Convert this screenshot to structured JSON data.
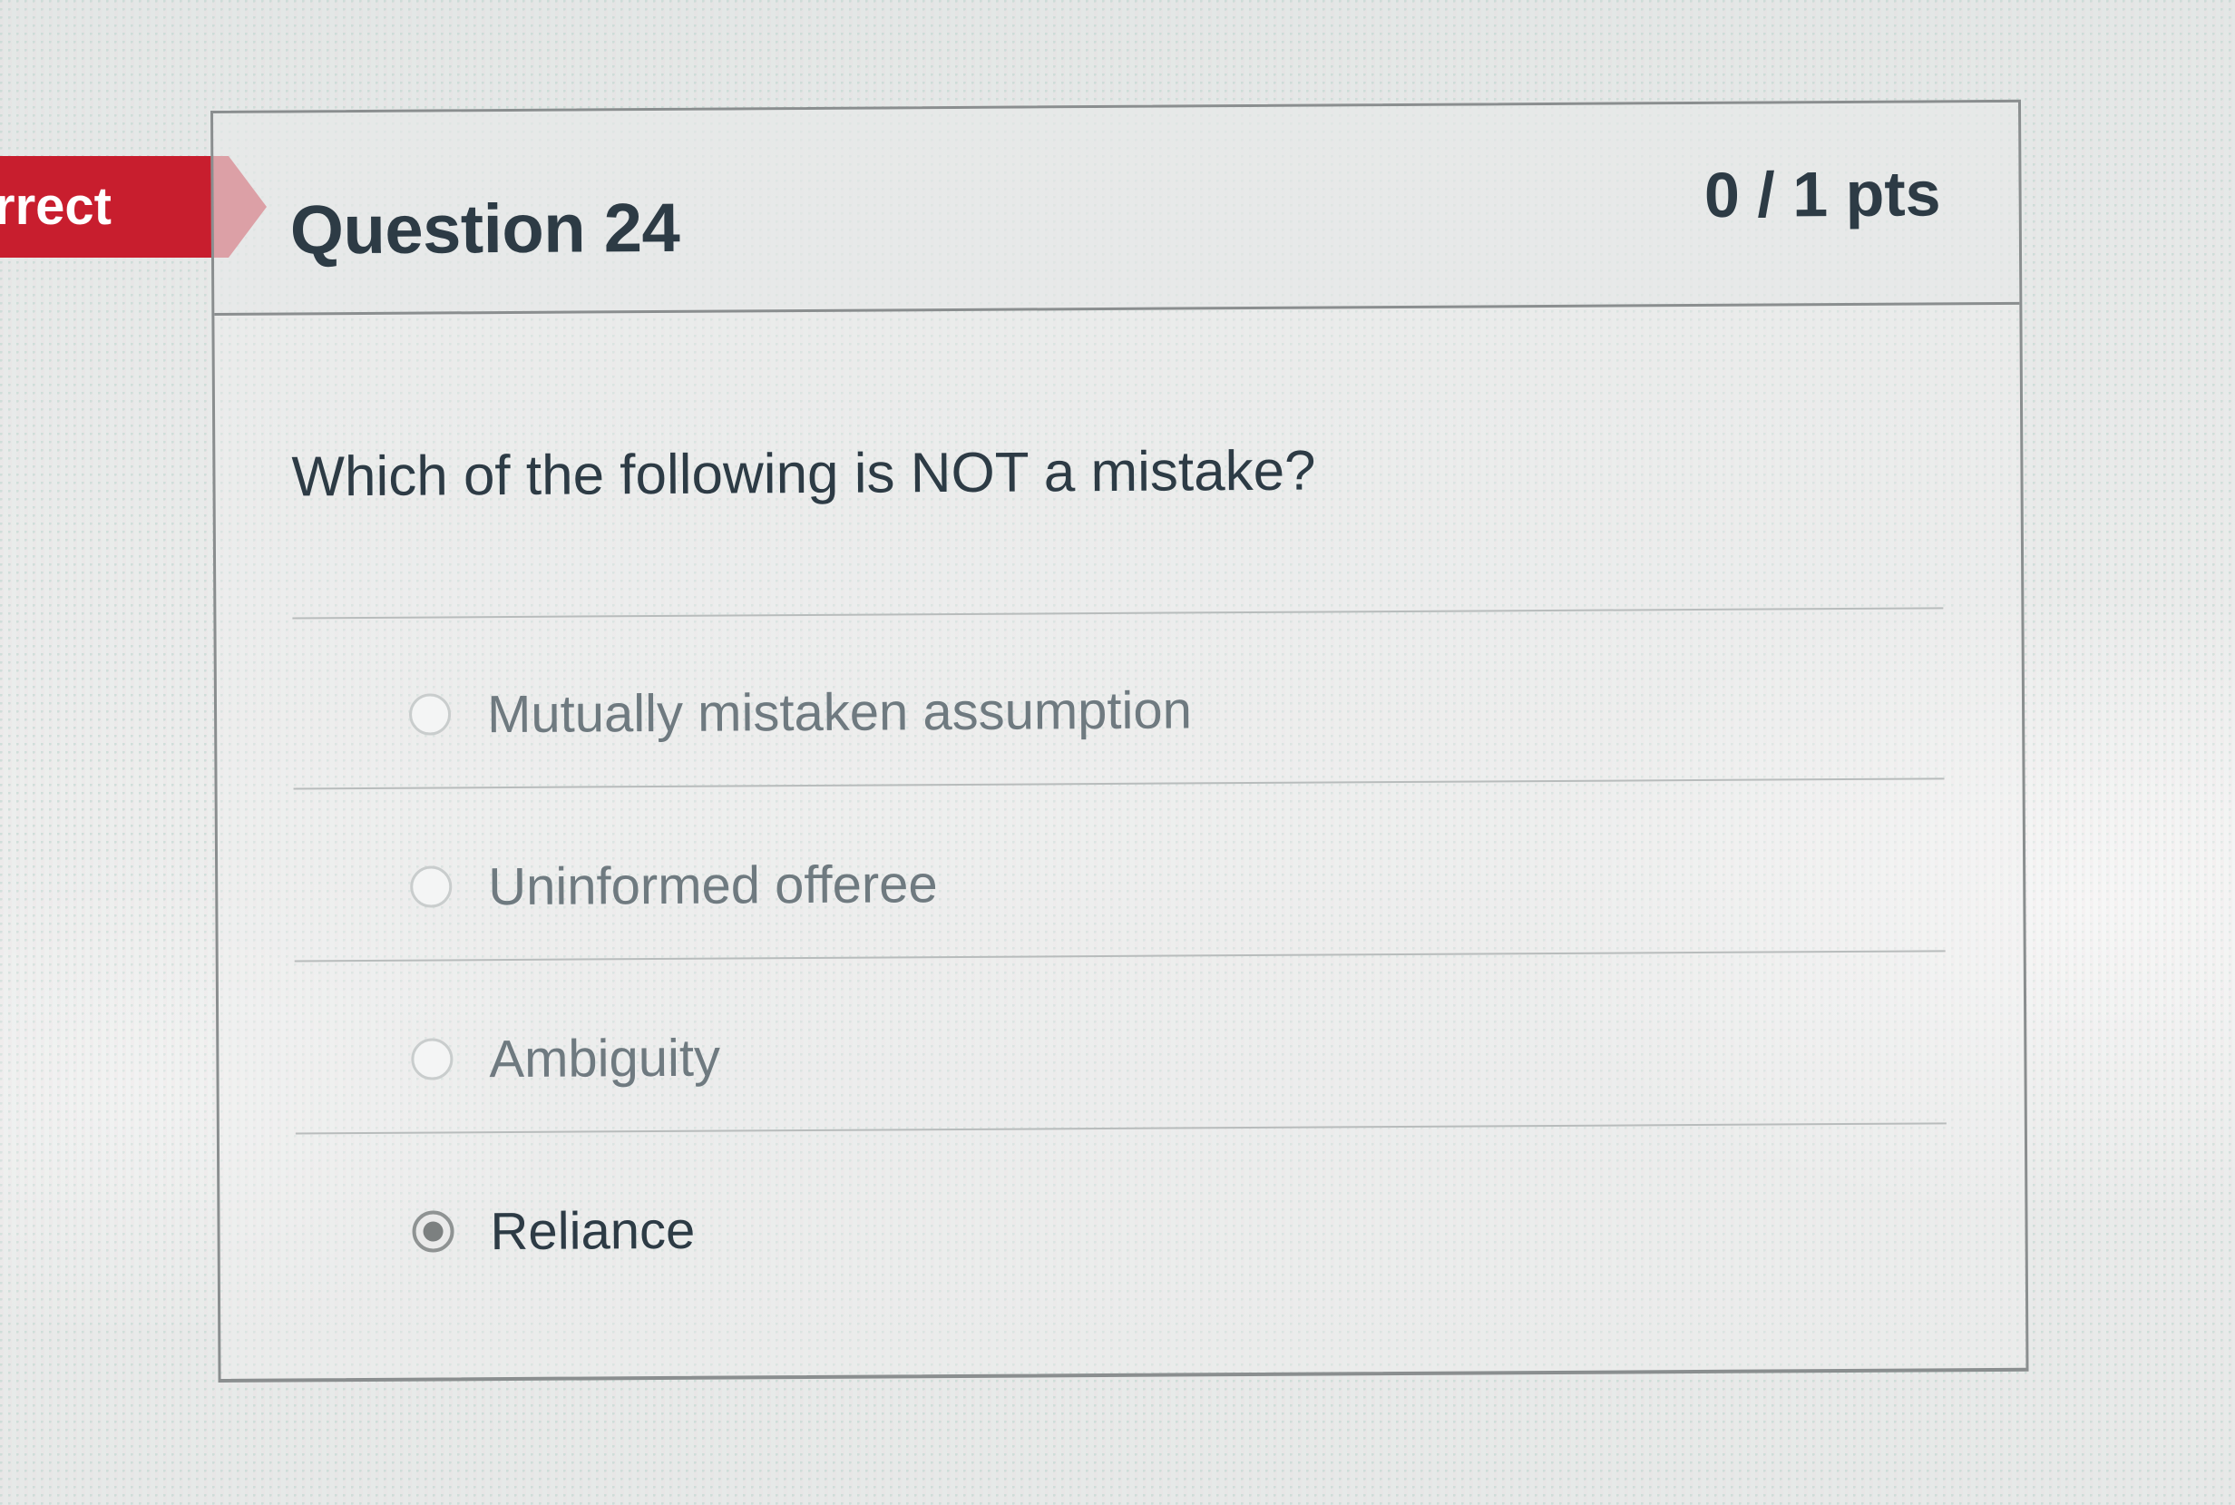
{
  "badge": {
    "label": "rrect"
  },
  "question": {
    "title": "Question 24",
    "points": "0 / 1 pts",
    "text": "Which of the following is NOT a mistake?"
  },
  "answers": [
    {
      "label": "Mutually mistaken assumption",
      "selected": false
    },
    {
      "label": "Uninformed offeree",
      "selected": false
    },
    {
      "label": "Ambiguity",
      "selected": false
    },
    {
      "label": "Reliance",
      "selected": true
    }
  ]
}
